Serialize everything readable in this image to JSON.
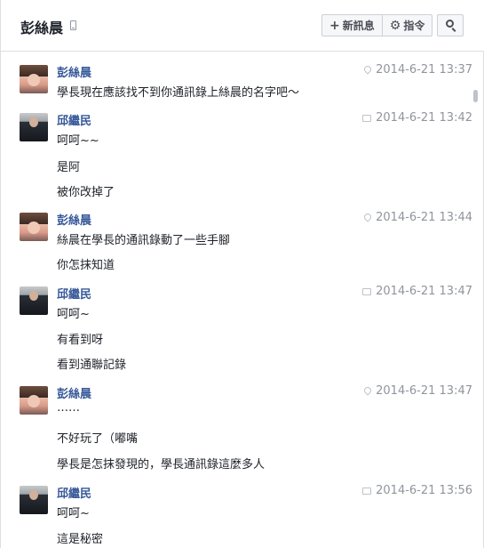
{
  "header": {
    "title": "彭絲晨",
    "new_message": "新訊息",
    "actions": "指令"
  },
  "icons": {
    "mobile": "mobile-phone-icon",
    "plus": "plus-icon",
    "gear": "gear-icon",
    "search": "search-icon",
    "location": "location-pin-icon",
    "chat": "chat-icon"
  },
  "colors": {
    "author": "#365899",
    "timestamp": "#90949c",
    "border": "#dddfe2"
  },
  "messages": [
    {
      "author": "彭絲晨",
      "time": "2014-6-21 13:37",
      "icon": "location-pin-icon",
      "lines": [
        "學長現在應該找不到你通訊錄上絲晨的名字吧～"
      ]
    },
    {
      "author": "邱繼民",
      "time": "2014-6-21 13:42",
      "icon": "chat-icon",
      "lines": [
        "呵呵~~",
        "是阿",
        "被你改掉了"
      ]
    },
    {
      "author": "彭絲晨",
      "time": "2014-6-21 13:44",
      "icon": "location-pin-icon",
      "lines": [
        "絲晨在學長的通訊錄動了一些手腳",
        "你怎抹知道"
      ]
    },
    {
      "author": "邱繼民",
      "time": "2014-6-21 13:47",
      "icon": "chat-icon",
      "lines": [
        "呵呵~",
        "有看到呀",
        "看到通聯記錄"
      ]
    },
    {
      "author": "彭絲晨",
      "time": "2014-6-21 13:47",
      "icon": "location-pin-icon",
      "lines": [
        "……",
        "不好玩了（嘟嘴",
        "學長是怎抹發現的，學長通訊錄這麼多人"
      ]
    },
    {
      "author": "邱繼民",
      "time": "2014-6-21 13:56",
      "icon": "chat-icon",
      "lines": [
        "呵呵~",
        "這是秘密"
      ]
    }
  ]
}
